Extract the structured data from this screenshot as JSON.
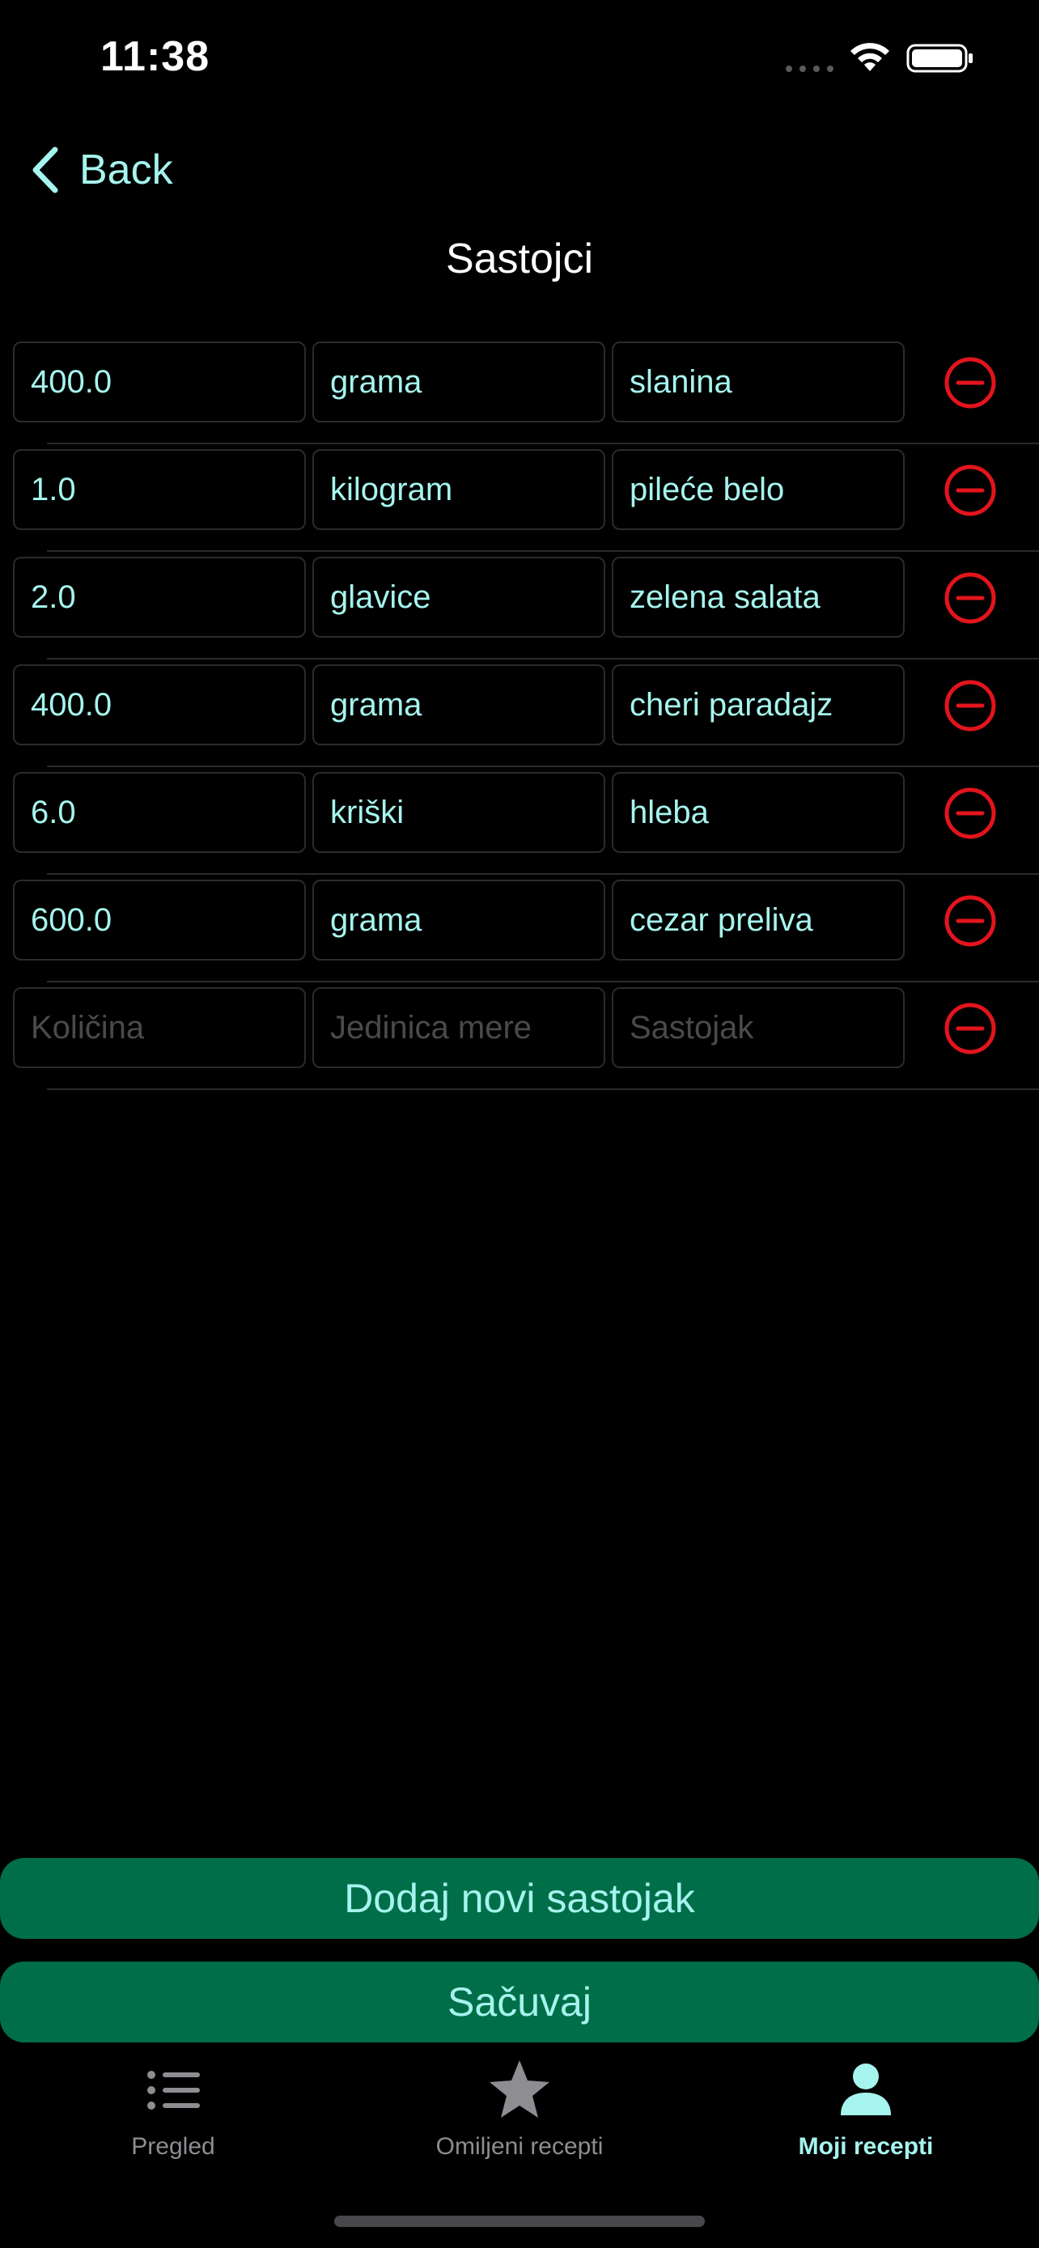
{
  "status_bar": {
    "time": "11:38"
  },
  "nav": {
    "back_label": "Back",
    "title": "Sastojci"
  },
  "colors": {
    "accent": "#a6f4ee",
    "destructive": "#e3141d",
    "button_bg": "#006e48",
    "background": "#000000"
  },
  "ingredients": [
    {
      "quantity": "400.0",
      "unit": "grama",
      "name": "slanina"
    },
    {
      "quantity": "1.0",
      "unit": "kilogram",
      "name": "pileće belo"
    },
    {
      "quantity": "2.0",
      "unit": "glavice",
      "name": "zelena salata"
    },
    {
      "quantity": "400.0",
      "unit": "grama",
      "name": "cheri paradajz"
    },
    {
      "quantity": "6.0",
      "unit": "kriški",
      "name": "hleba"
    },
    {
      "quantity": "600.0",
      "unit": "grama",
      "name": "cezar preliva"
    },
    {
      "quantity": "",
      "unit": "",
      "name": ""
    }
  ],
  "placeholders": {
    "quantity": "Količina",
    "unit": "Jedinica mere",
    "name": "Sastojak"
  },
  "buttons": {
    "add_label": "Dodaj novi sastojak",
    "save_label": "Sačuvaj"
  },
  "tabs": [
    {
      "label": "Pregled",
      "icon": "list-icon",
      "active": false
    },
    {
      "label": "Omiljeni recepti",
      "icon": "star-icon",
      "active": false
    },
    {
      "label": "Moji recepti",
      "icon": "person-icon",
      "active": true
    }
  ]
}
